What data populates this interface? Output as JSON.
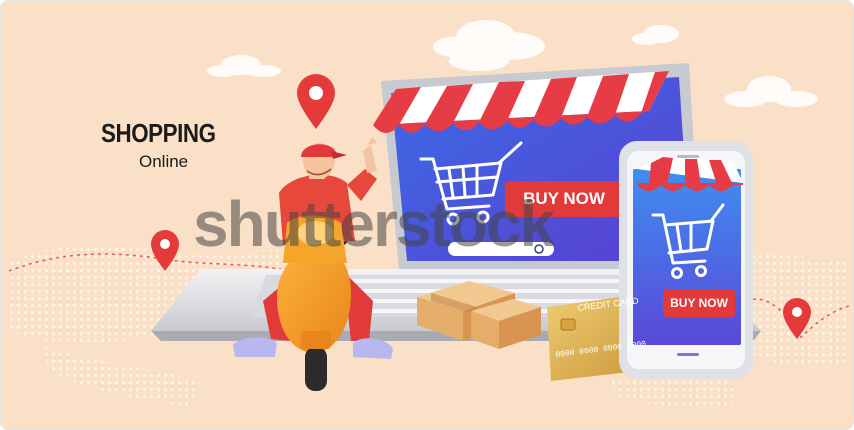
{
  "illustration": {
    "heading": "SHOPPING",
    "subheading": "Online",
    "laptop_button": "BUY NOW",
    "phone_button": "BUY NOW",
    "card_label": "CREDIT CARD",
    "card_number": "0000  0000  0000  0000"
  },
  "watermark": "shutterstock",
  "colors": {
    "background": "#fbe0c8",
    "red": "#e23a3a",
    "screen_blue": "#3a5bd8",
    "scooter_orange": "#f39a24",
    "card_gold": "#e0b054"
  },
  "icons": [
    "map-pin-icon",
    "shopping-cart-icon",
    "cloud-icon",
    "cardboard-box-icon",
    "credit-card-icon"
  ]
}
